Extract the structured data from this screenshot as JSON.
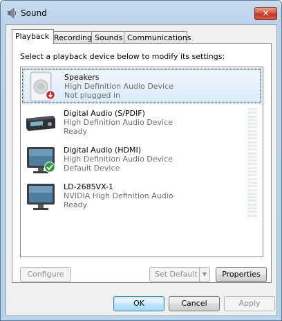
{
  "window": {
    "title": "Sound",
    "close_label": "✕"
  },
  "tabs": [
    {
      "label": "Playback",
      "active": true
    },
    {
      "label": "Recording",
      "active": false
    },
    {
      "label": "Sounds",
      "active": false
    },
    {
      "label": "Communications",
      "active": false
    }
  ],
  "panel": {
    "instruction": "Select a playback device below to modify its settings:",
    "devices": [
      {
        "name": "Speakers",
        "driver": "High Definition Audio Device",
        "status": "Not plugged in",
        "icon": "speaker-icon",
        "badge": "unplugged-badge",
        "selected": true
      },
      {
        "name": "Digital Audio (S/PDIF)",
        "driver": "High Definition Audio Device",
        "status": "Ready",
        "icon": "receiver-icon",
        "selected": false
      },
      {
        "name": "Digital Audio (HDMI)",
        "driver": "High Definition Audio Device",
        "status": "Default Device",
        "icon": "monitor-icon",
        "badge": "default-check-badge",
        "selected": false
      },
      {
        "name": "LD-2685VX-1",
        "driver": "NVIDIA High Definition Audio",
        "status": "Ready",
        "icon": "monitor-icon",
        "selected": false
      }
    ],
    "configure_label": "Configure",
    "set_default_label": "Set Default",
    "properties_label": "Properties"
  },
  "footer": {
    "ok_label": "OK",
    "cancel_label": "Cancel",
    "apply_label": "Apply"
  },
  "colors": {
    "title_bg": "#bcd3ea",
    "close_red": "#c0351f",
    "selection": "#dcebfc"
  }
}
